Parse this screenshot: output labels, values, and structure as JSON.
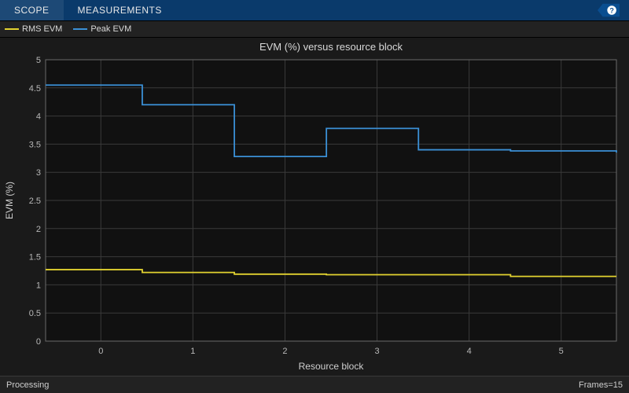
{
  "topbar": {
    "menu": [
      "SCOPE",
      "MEASUREMENTS"
    ],
    "help_icon": "help-icon"
  },
  "legend": {
    "items": [
      {
        "label": "RMS EVM",
        "color": "#e2d230"
      },
      {
        "label": "Peak EVM",
        "color": "#3b90d6"
      }
    ]
  },
  "chart_data": {
    "type": "line",
    "title": "EVM (%) versus resource block",
    "xlabel": "Resource block",
    "ylabel": "EVM (%)",
    "xlim": [
      -0.6,
      5.6
    ],
    "ylim": [
      0,
      5
    ],
    "xticks": [
      0,
      1,
      2,
      3,
      4,
      5
    ],
    "yticks": [
      0,
      0.5,
      1,
      1.5,
      2,
      2.5,
      3,
      3.5,
      4,
      4.5,
      5
    ],
    "step_mode": "hv",
    "series": [
      {
        "name": "RMS EVM",
        "color": "#e2d230",
        "x": [
          -0.6,
          0.45,
          1.45,
          2.45,
          3.45,
          4.45,
          5.6
        ],
        "y": [
          1.27,
          1.22,
          1.19,
          1.18,
          1.18,
          1.15,
          1.15
        ]
      },
      {
        "name": "Peak EVM",
        "color": "#3b90d6",
        "x": [
          -0.6,
          0.45,
          1.45,
          2.45,
          3.45,
          4.45,
          5.6
        ],
        "y": [
          4.55,
          4.2,
          3.28,
          3.78,
          3.4,
          3.38,
          3.35
        ]
      }
    ]
  },
  "status": {
    "left": "Processing",
    "right": "Frames=15"
  }
}
